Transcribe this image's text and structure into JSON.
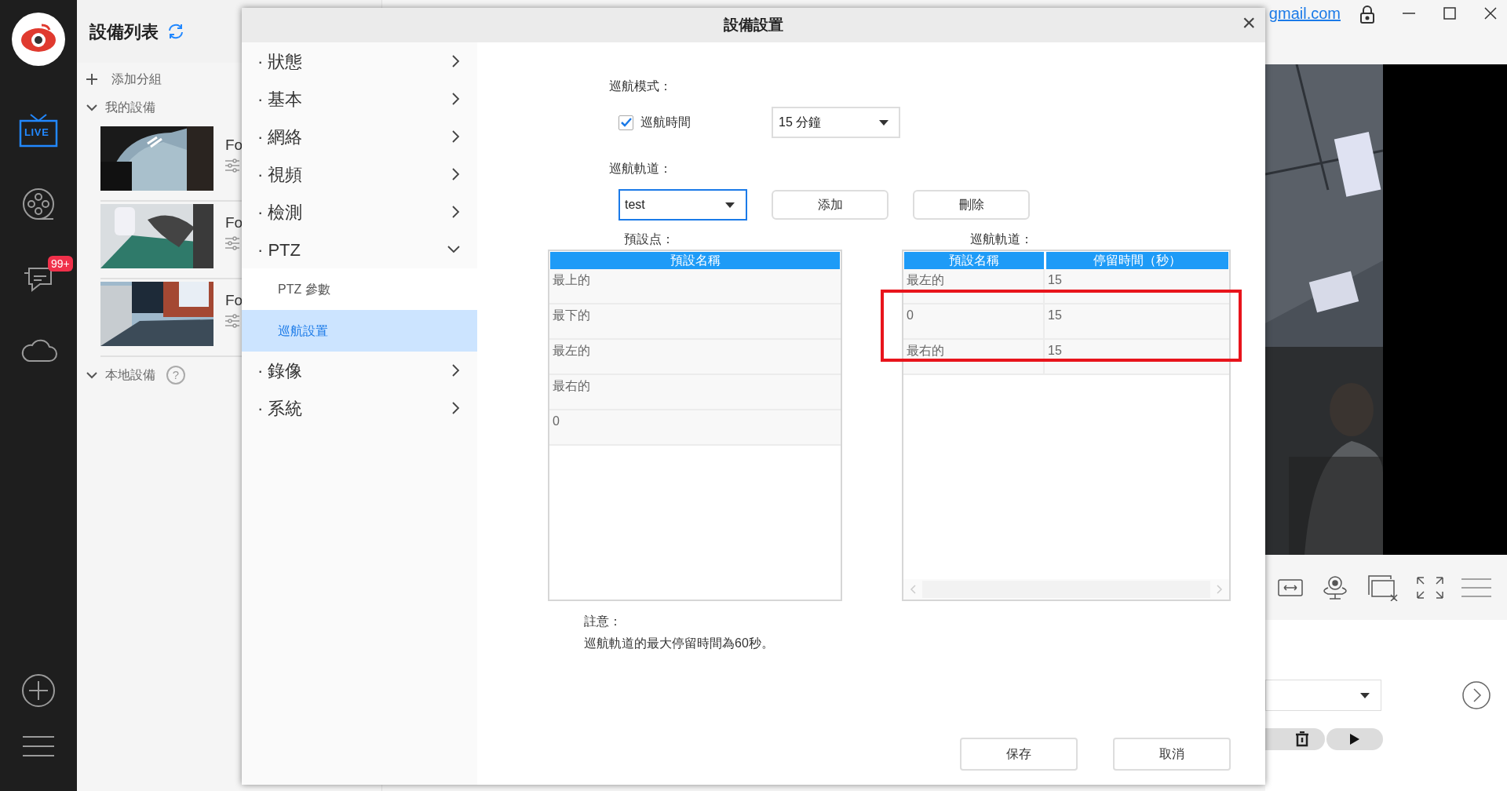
{
  "rail": {
    "items": [
      {
        "kind": "live",
        "label": "LIVE",
        "selected": true
      },
      {
        "kind": "playback",
        "selected": false
      },
      {
        "kind": "messages",
        "badge": "99+",
        "selected": false
      },
      {
        "kind": "cloud",
        "selected": false
      }
    ]
  },
  "device_panel": {
    "title": "設備列表",
    "add_group": "添加分組",
    "groups": [
      {
        "label": "我的設備",
        "expanded": true,
        "devices": [
          {
            "name": "Fo"
          },
          {
            "name": "Fo"
          },
          {
            "name": "Fo"
          }
        ]
      },
      {
        "label": "本地設備",
        "expanded": true,
        "help": "?"
      }
    ]
  },
  "top_bar": {
    "account": "gmail.com"
  },
  "dialog": {
    "title": "設備設置",
    "close": "×",
    "nav": [
      {
        "label": "· 狀態",
        "expanded": false
      },
      {
        "label": "· 基本",
        "expanded": false
      },
      {
        "label": "· 網絡",
        "expanded": false
      },
      {
        "label": "· 視頻",
        "expanded": false
      },
      {
        "label": "· 檢測",
        "expanded": false
      },
      {
        "label": "· PTZ",
        "expanded": true,
        "children": [
          {
            "label": "PTZ 參數",
            "selected": false
          },
          {
            "label": "巡航設置",
            "selected": true
          }
        ]
      },
      {
        "label": "· 錄像",
        "expanded": false
      },
      {
        "label": "· 系統",
        "expanded": false
      }
    ],
    "cruise_mode_label": "巡航模式：",
    "cruise_time": {
      "label": "巡航時間",
      "checked": true,
      "value": "15 分鐘"
    },
    "cruise_track_label": "巡航軌道：",
    "track_select": {
      "value": "test",
      "focused": true
    },
    "buttons": [
      "添加",
      "刪除"
    ],
    "presets": {
      "label": "預設点：",
      "columns": [
        "預設名稱"
      ],
      "rows": [
        [
          "最上的"
        ],
        [
          "最下的"
        ],
        [
          "最左的"
        ],
        [
          "最右的"
        ],
        [
          "0"
        ]
      ]
    },
    "track": {
      "label": "巡航軌道：",
      "columns": [
        "預設名稱",
        "停留時間（秒）"
      ],
      "rows": [
        [
          "最左的",
          "15"
        ],
        [
          "0",
          "15"
        ],
        [
          "最右的",
          "15"
        ]
      ]
    },
    "note_title": "註意：",
    "note": "巡航軌道的最大停留時間為60秒。",
    "footer_buttons": [
      "保存",
      "取消"
    ]
  }
}
